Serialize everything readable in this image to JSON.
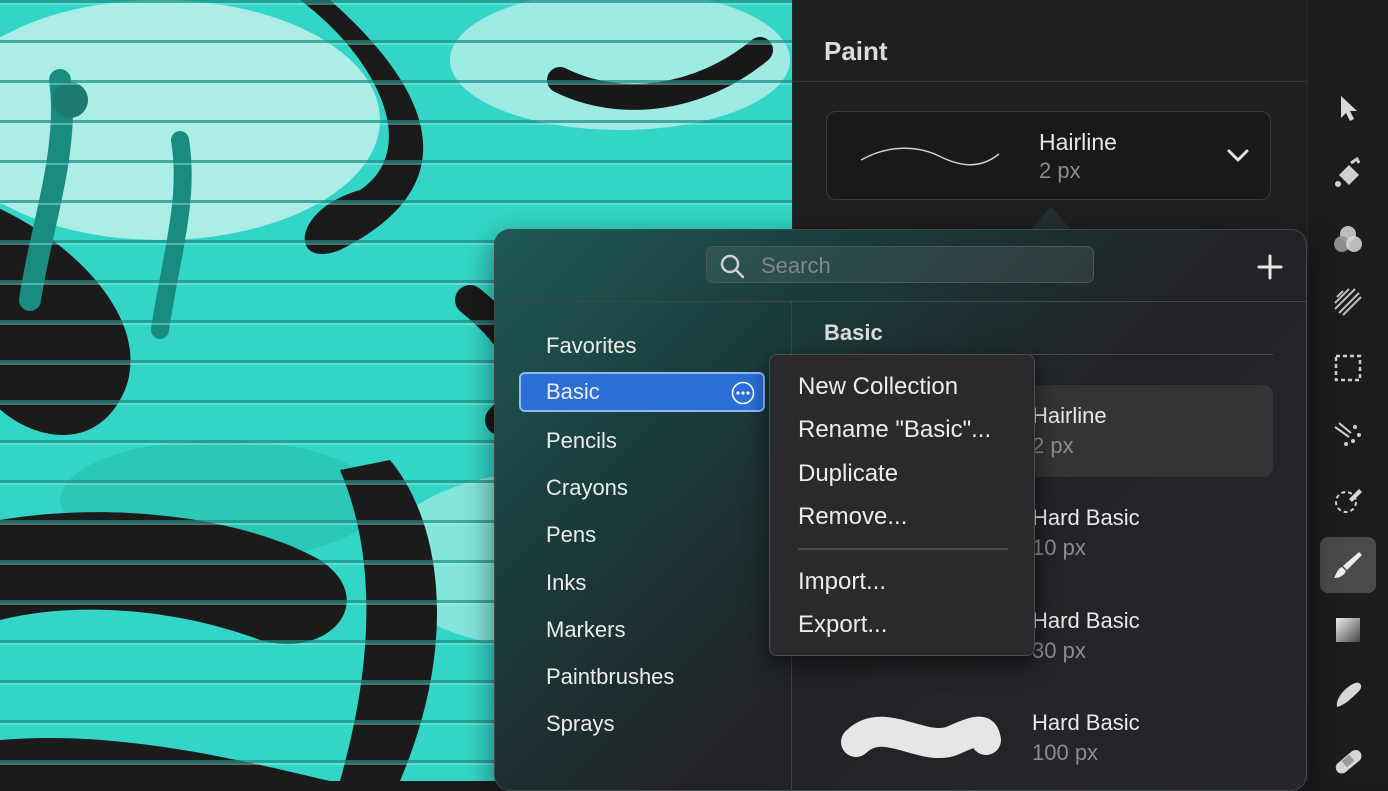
{
  "panel": {
    "title": "Paint",
    "current_brush": {
      "name": "Hairline",
      "size": "2 px"
    }
  },
  "popover": {
    "search": {
      "placeholder": "Search"
    },
    "collections": [
      {
        "label": "Favorites",
        "selected": false
      },
      {
        "label": "Basic",
        "selected": true
      },
      {
        "label": "Pencils",
        "selected": false
      },
      {
        "label": "Crayons",
        "selected": false
      },
      {
        "label": "Pens",
        "selected": false
      },
      {
        "label": "Inks",
        "selected": false
      },
      {
        "label": "Markers",
        "selected": false
      },
      {
        "label": "Paintbrushes",
        "selected": false
      },
      {
        "label": "Sprays",
        "selected": false
      }
    ],
    "brushes_title": "Basic",
    "brushes": [
      {
        "name": "Hairline",
        "size": "2 px",
        "selected": true
      },
      {
        "name": "Hard Basic",
        "size": "10 px",
        "selected": false
      },
      {
        "name": "Hard Basic",
        "size": "30 px",
        "selected": false
      },
      {
        "name": "Hard Basic",
        "size": "100 px",
        "selected": false
      }
    ]
  },
  "context_menu": {
    "items": [
      "New Collection",
      "Rename \"Basic\"...",
      "Duplicate",
      "Remove...",
      "Import...",
      "Export..."
    ]
  },
  "toolbar": {
    "tools": [
      "pointer-icon",
      "fill-bucket-icon",
      "color-mix-icon",
      "texture-icon",
      "selection-marquee-icon",
      "scatter-icon",
      "lasso-brush-icon",
      "paintbrush-icon",
      "gradient-icon",
      "smudge-icon",
      "bandage-icon"
    ],
    "active_tool": "paintbrush-icon"
  },
  "colors": {
    "accent": "#2b6fd6",
    "canvas": "#2fd3c2"
  }
}
